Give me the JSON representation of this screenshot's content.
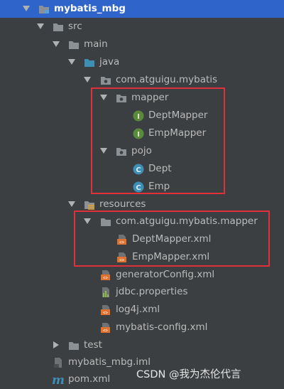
{
  "project": {
    "name": "mybatis_mbg"
  },
  "tree": {
    "src": "src",
    "main": "main",
    "java": "java",
    "base_package": "com.atguigu.mybatis",
    "mapper_pkg": "mapper",
    "dept_mapper": "DeptMapper",
    "emp_mapper": "EmpMapper",
    "pojo_pkg": "pojo",
    "dept": "Dept",
    "emp": "Emp",
    "resources": "resources",
    "res_mapper_pkg": "com.atguigu.mybatis.mapper",
    "dept_mapper_xml": "DeptMapper.xml",
    "emp_mapper_xml": "EmpMapper.xml",
    "generator_config": "generatorConfig.xml",
    "jdbc_props": "jdbc.properties",
    "log4j": "log4j.xml",
    "mybatis_config": "mybatis-config.xml",
    "test": "test",
    "iml": "mybatis_mbg.iml",
    "pom": "pom.xml"
  },
  "icons": {
    "interface_letter": "I",
    "class_letter": "C",
    "xml_glyph": "<>",
    "maven_letter": "m"
  },
  "colors": {
    "background": "#3c3f41",
    "selection": "#2f65ca",
    "highlight_box": "#e0303a",
    "interface_icon": "#5b8a3c",
    "class_icon": "#3d8fb5",
    "xml_icon": "#e0722f",
    "folder": "#8c9196"
  },
  "watermark": "CSDN @我为杰伦代言"
}
